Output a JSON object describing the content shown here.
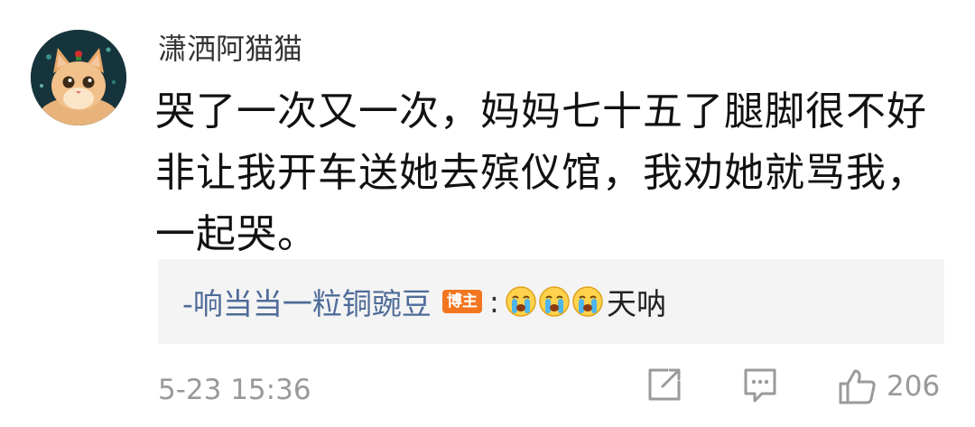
{
  "comment": {
    "author": "潇洒阿猫猫",
    "avatar_icon": "cat-avatar",
    "text": "哭了一次又一次，妈妈七十五了腿脚很不好非让我开车送她去殡仪馆，我劝她就骂我，一起哭。",
    "reply": {
      "author": "-响当当一粒铜豌豆",
      "badge": "博主",
      "colon": ":",
      "emojis": [
        "crying-face-icon",
        "crying-face-icon",
        "crying-face-icon"
      ],
      "text": "天呐"
    },
    "timestamp": "5-23 15:36",
    "actions": {
      "share_icon": "share-icon",
      "comment_icon": "comment-icon",
      "like_icon": "thumbs-up-icon",
      "like_count": "206"
    }
  },
  "colors": {
    "reply_author": "#4e6b99",
    "badge": "#f2761f",
    "meta": "#999999"
  }
}
